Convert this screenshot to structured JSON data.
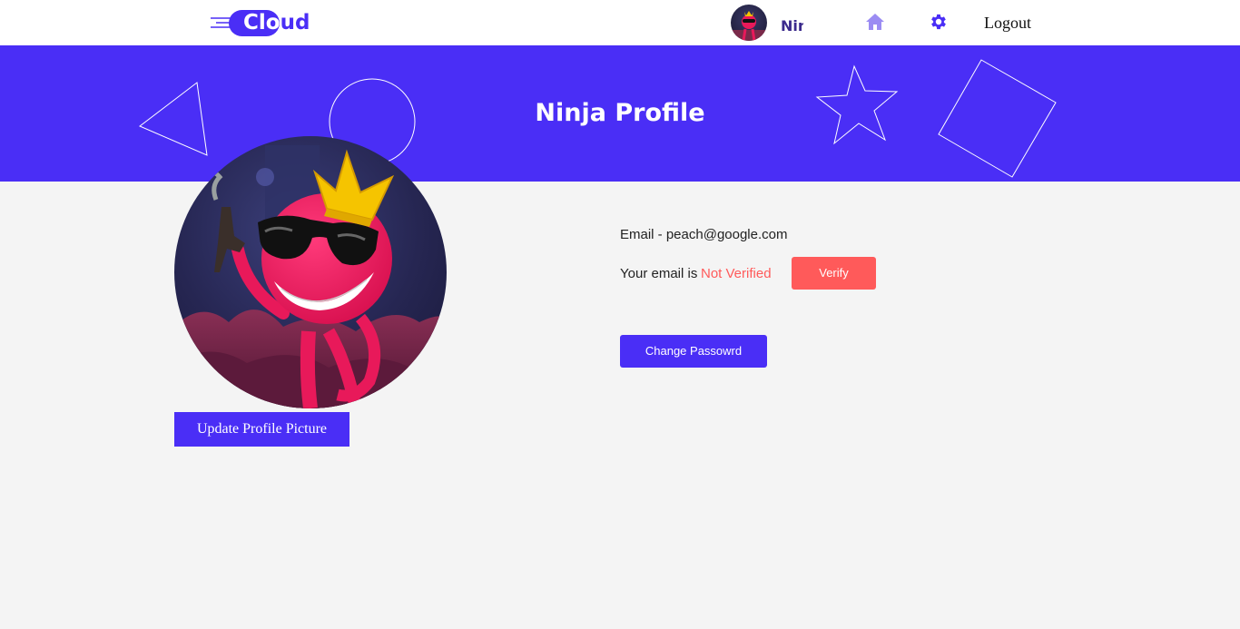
{
  "nav": {
    "logo_text_white": "Cl",
    "logo_text_blue": "ud",
    "logo_text_o": "o",
    "username": "Ninja",
    "logout_label": "Logout",
    "home_icon": "home-icon",
    "settings_icon": "gear-icon"
  },
  "banner": {
    "title": "Ninja Profile"
  },
  "profile": {
    "update_picture_label": "Update Profile Picture",
    "email_label": "Email - ",
    "email_value": "peach@google.com",
    "verify_prefix": "Your email is",
    "verify_status": "Not Verified",
    "verify_button": "Verify",
    "change_password_button": "Change Passowrd"
  },
  "colors": {
    "brand": "#4a2ef6",
    "danger": "#ff5a5a",
    "background": "#f4f4f4"
  }
}
